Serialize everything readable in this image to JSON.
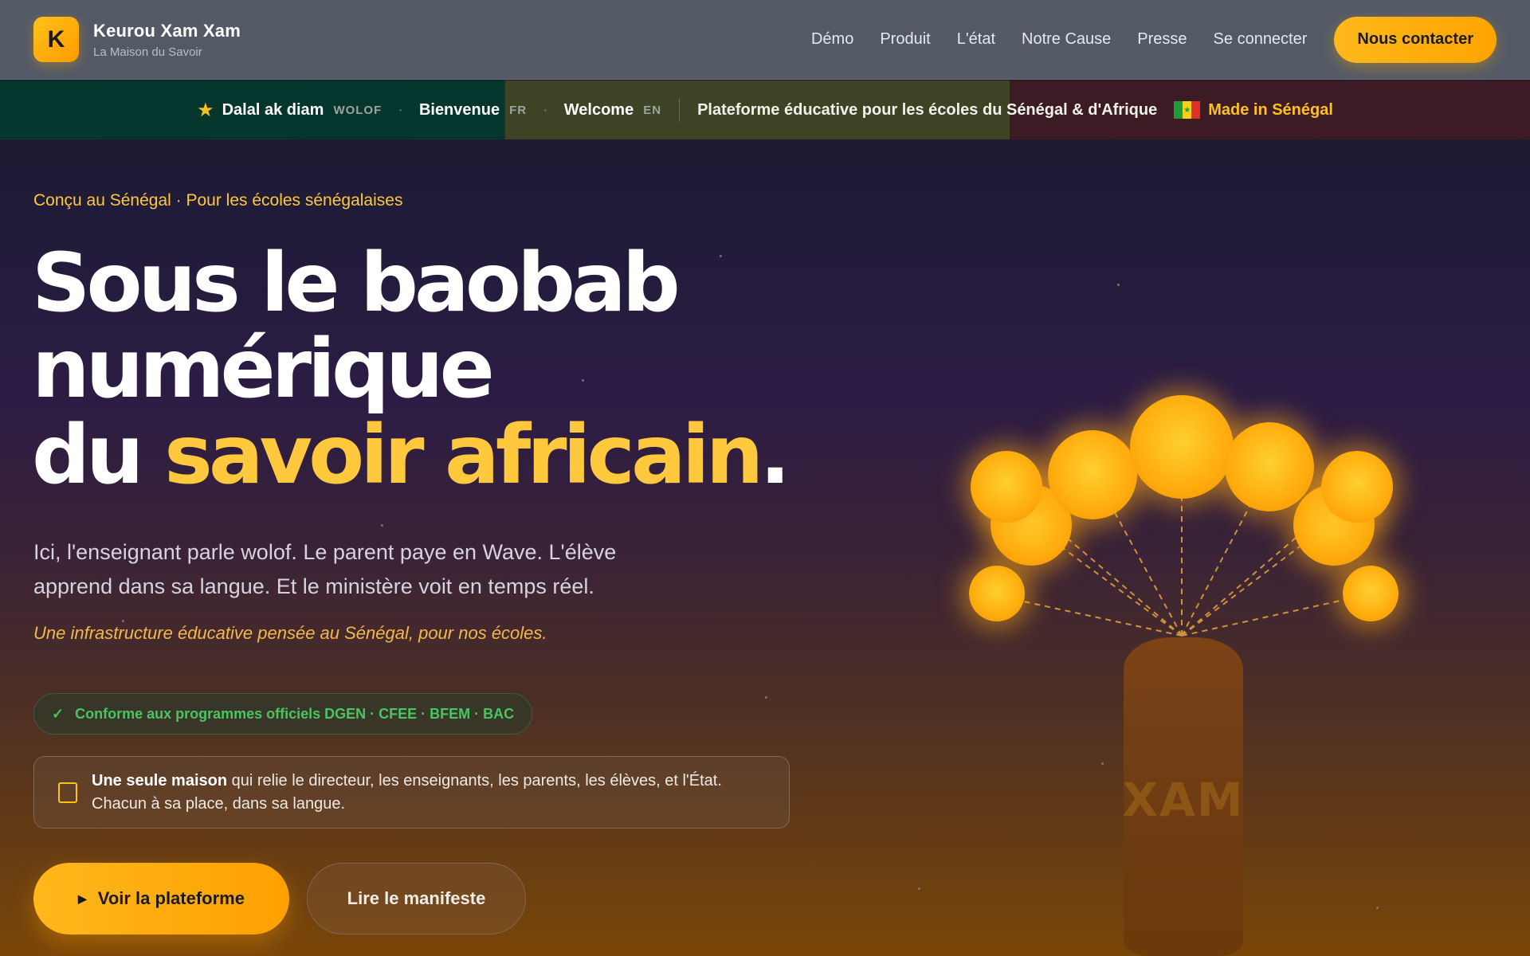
{
  "header": {
    "logo_letter": "K",
    "brand_name": "Keurou Xam Xam",
    "brand_sub": "La Maison du Savoir",
    "nav": [
      "Démo",
      "Produit",
      "L'état",
      "Notre Cause",
      "Presse",
      "Se connecter"
    ],
    "cta": "Nous contacter"
  },
  "ribbon": {
    "items": [
      {
        "word": "Dalal ak diam",
        "lang": "WOLOF"
      },
      {
        "word": "Bienvenue",
        "lang": "FR"
      },
      {
        "word": "Welcome",
        "lang": "EN"
      }
    ],
    "tagline": "Plateforme éducative pour les écoles du Sénégal & d'Afrique",
    "made_in": "Made in Sénégal"
  },
  "hero": {
    "eyebrow": "Conçu au Sénégal · Pour les écoles sénégalaises",
    "headline_line1": "Sous le baobab",
    "headline_line2": "numérique",
    "headline_line3_prefix": "du ",
    "headline_line3_accent": "savoir africain",
    "headline_line3_suffix": ".",
    "lead": "Ici, l'enseignant parle wolof. Le parent paye en Wave. L'élève apprend dans sa langue. Et le ministère voit en temps réel.",
    "quote": "Une infrastructure éducative pensée au Sénégal, pour nos écoles.",
    "conformity": "Conforme aux programmes officiels DGEN · CFEE · BFEM · BAC",
    "house_bold": "Une seule maison",
    "house_text": " qui relie le directeur, les enseignants, les parents, les élèves, et l'État. Chacun à sa place, dans sa langue.",
    "primary_button": "Voir la plateforme",
    "secondary_button": "Lire le manifeste"
  },
  "illustration": {
    "trunk_label": "XAM"
  },
  "colors": {
    "accent": "#ffc83d",
    "cta": "#ffb000",
    "success": "#48c562"
  },
  "icons": {
    "star": "star-icon",
    "check": "check-icon",
    "book": "book-icon",
    "play": "play-icon",
    "flag": "senegal-flag-icon"
  }
}
